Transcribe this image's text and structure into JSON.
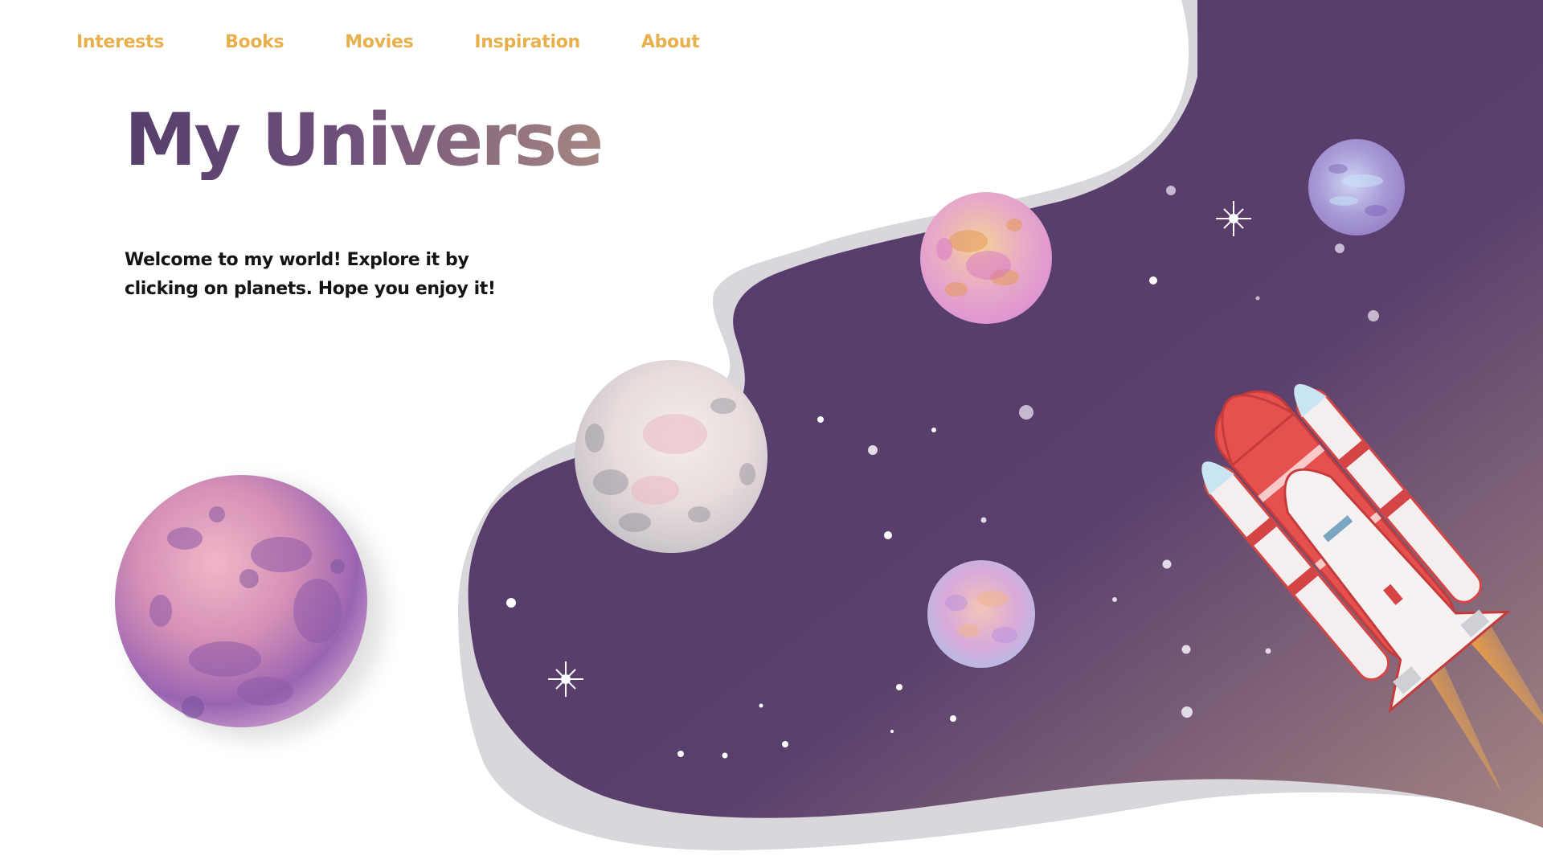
{
  "nav": {
    "items": [
      {
        "label": "Interests"
      },
      {
        "label": "Books"
      },
      {
        "label": "Movies"
      },
      {
        "label": "Inspiration"
      },
      {
        "label": "About"
      }
    ]
  },
  "hero": {
    "title": "My Universe",
    "welcome": "Welcome to my world! Explore it by clicking on planets. Hope you enjoy it!"
  },
  "colors": {
    "nav_text": "#e8b04d",
    "space_dark": "#553b6b",
    "space_light": "#a58682",
    "body_text": "#141414"
  },
  "icons": [
    "planet-icon",
    "sparkle-star-icon",
    "rocket-icon"
  ]
}
